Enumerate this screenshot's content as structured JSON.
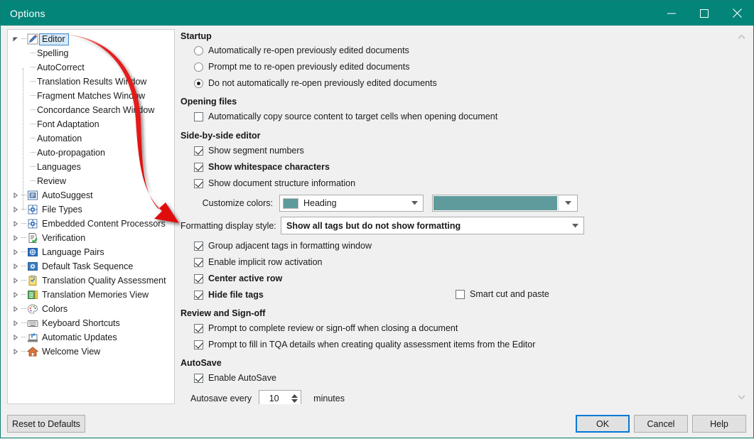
{
  "window": {
    "title": "Options",
    "accent_color": "#04857a",
    "controls": [
      {
        "name": "minimize",
        "glyph": "minimize-icon"
      },
      {
        "name": "maximize",
        "glyph": "maximize-icon"
      },
      {
        "name": "close",
        "glyph": "close-icon"
      }
    ]
  },
  "tree": {
    "items": [
      {
        "label": "Editor",
        "level": 1,
        "icon": "pencil-icon",
        "expander": "collapse",
        "selected": true
      },
      {
        "label": "Spelling",
        "level": 2,
        "icon": "none",
        "expander": "none",
        "selected": false
      },
      {
        "label": "AutoCorrect",
        "level": 2,
        "icon": "none",
        "expander": "none",
        "selected": false
      },
      {
        "label": "Translation Results Window",
        "level": 2,
        "icon": "none",
        "expander": "none",
        "selected": false
      },
      {
        "label": "Fragment Matches Window",
        "level": 2,
        "icon": "none",
        "expander": "none",
        "selected": false
      },
      {
        "label": "Concordance Search Window",
        "level": 2,
        "icon": "none",
        "expander": "none",
        "selected": false
      },
      {
        "label": "Font Adaptation",
        "level": 2,
        "icon": "none",
        "expander": "none",
        "selected": false
      },
      {
        "label": "Automation",
        "level": 2,
        "icon": "none",
        "expander": "none",
        "selected": false
      },
      {
        "label": "Auto-propagation",
        "level": 2,
        "icon": "none",
        "expander": "none",
        "selected": false
      },
      {
        "label": "Languages",
        "level": 2,
        "icon": "none",
        "expander": "none",
        "selected": false
      },
      {
        "label": "Review",
        "level": 2,
        "icon": "none",
        "expander": "none",
        "selected": false
      },
      {
        "label": "AutoSuggest",
        "level": 1,
        "icon": "autosuggest-icon",
        "expander": "expand",
        "selected": false
      },
      {
        "label": "File Types",
        "level": 1,
        "icon": "file-types-icon",
        "expander": "expand",
        "selected": false
      },
      {
        "label": "Embedded Content Processors",
        "level": 1,
        "icon": "processors-icon",
        "expander": "expand",
        "selected": false
      },
      {
        "label": "Verification",
        "level": 1,
        "icon": "verification-icon",
        "expander": "expand",
        "selected": false
      },
      {
        "label": "Language Pairs",
        "level": 1,
        "icon": "language-pairs-icon",
        "expander": "expand",
        "selected": false
      },
      {
        "label": "Default Task Sequence",
        "level": 1,
        "icon": "task-sequence-icon",
        "expander": "expand",
        "selected": false
      },
      {
        "label": "Translation Quality Assessment",
        "level": 1,
        "icon": "clipboard-icon",
        "expander": "expand",
        "selected": false
      },
      {
        "label": "Translation Memories View",
        "level": 1,
        "icon": "memories-icon",
        "expander": "expand",
        "selected": false
      },
      {
        "label": "Colors",
        "level": 1,
        "icon": "palette-icon",
        "expander": "expand",
        "selected": false
      },
      {
        "label": "Keyboard Shortcuts",
        "level": 1,
        "icon": "keyboard-icon",
        "expander": "expand",
        "selected": false
      },
      {
        "label": "Automatic Updates",
        "level": 1,
        "icon": "updates-icon",
        "expander": "expand",
        "selected": false
      },
      {
        "label": "Welcome View",
        "level": 1,
        "icon": "home-icon",
        "expander": "expand",
        "selected": false
      }
    ]
  },
  "panel": {
    "startup": {
      "header": "Startup",
      "options": [
        {
          "label": "Automatically re-open previously edited documents",
          "checked": false
        },
        {
          "label": "Prompt me to re-open previously edited documents",
          "checked": false
        },
        {
          "label": "Do not automatically re-open previously edited documents",
          "checked": true
        }
      ]
    },
    "opening_files": {
      "header": "Opening files",
      "options": [
        {
          "label": "Automatically copy source content to target cells when opening document",
          "checked": false,
          "bold": false
        }
      ]
    },
    "side_by_side": {
      "header": "Side-by-side editor",
      "options": [
        {
          "label": "Show segment numbers",
          "checked": true,
          "bold": false
        },
        {
          "label": "Show whitespace characters",
          "checked": true,
          "bold": true
        },
        {
          "label": "Show document structure information",
          "checked": true,
          "bold": false
        }
      ],
      "customize_colors": {
        "label": "Customize colors:",
        "style_value": "Heading",
        "style_swatch": "#5f9b9c",
        "color_value": "#5f9b9c"
      },
      "formatting_display": {
        "label": "Formatting display style:",
        "value": "Show all tags but do not show formatting"
      },
      "options2": [
        {
          "label": "Group adjacent tags in formatting window",
          "checked": true,
          "bold": false
        },
        {
          "label": "Enable implicit row activation",
          "checked": true,
          "bold": false
        },
        {
          "label": "Center active row",
          "checked": true,
          "bold": true
        },
        {
          "label": "Hide file tags",
          "checked": true,
          "bold": true
        }
      ],
      "smart_cut_paste": {
        "label": "Smart cut and paste",
        "checked": false
      }
    },
    "review": {
      "header": "Review and Sign-off",
      "options": [
        {
          "label": "Prompt to complete review or sign-off when closing a document",
          "checked": true,
          "bold": false
        },
        {
          "label": "Prompt to fill in TQA details when creating quality assessment items from the Editor",
          "checked": true,
          "bold": false
        }
      ]
    },
    "autosave": {
      "header": "AutoSave",
      "options": [
        {
          "label": "Enable AutoSave",
          "checked": true,
          "bold": false
        }
      ],
      "interval": {
        "prefix_label": "Autosave every",
        "value": "10",
        "suffix_label": "minutes"
      }
    }
  },
  "footer": {
    "reset_label": "Reset to Defaults",
    "ok_label": "OK",
    "cancel_label": "Cancel",
    "help_label": "Help"
  },
  "annotation": {
    "arrow_color": "#e81717",
    "points_from": "Editor",
    "points_to": "Formatting display style:"
  }
}
